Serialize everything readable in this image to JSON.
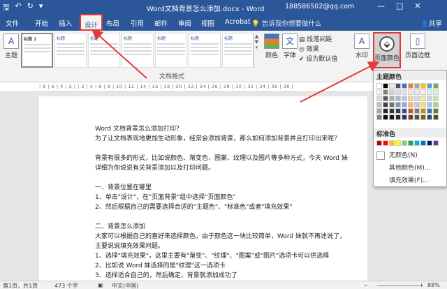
{
  "titlebar": {
    "title": "Word文档背景怎么添加.docx - Word",
    "user": "188586502@qq.com",
    "qat_save_icon": "save-icon",
    "undo": "↶",
    "redo": "↻",
    "save": "🖫",
    "quick": "▾",
    "restore_icon": "restore-icon",
    "minimize": "—",
    "maximize": "□",
    "close": "✕"
  },
  "tabs": {
    "file": "文件",
    "home": "开始",
    "insert": "插入",
    "design": "设计",
    "layout": "布局",
    "references": "引用",
    "mailings": "邮件",
    "review": "审阅",
    "view": "视图",
    "acrobat": "Acrobat",
    "tellme": "告诉我你想要做什么",
    "share": "共享"
  },
  "ribbon": {
    "theme": "主题",
    "style_first": "标题 1",
    "style_titles": [
      "标题",
      "标题",
      "标题",
      "标题",
      "标题",
      "标题"
    ],
    "colors": "颜色",
    "fonts": "字体",
    "fonts_glyph": "文",
    "paragraph_spacing": "段落间距",
    "effects": "效果",
    "set_default": "设为默认值",
    "watermark": "水印",
    "page_color": "页面颜色",
    "page_border": "页面边框",
    "group_label": "文档格式"
  },
  "ruler": "| 8 | 6 | 4 | 2 |   | 2 | 4 | 6 | 8 | 10 | 12 | 14 | 16 | 18 | 20 | 22 | 24 | 26 | 28 | 30 | 32 | 34 | 36 | 38 |",
  "document": {
    "lines": [
      "Word 文档背景怎么添加打印？",
      "为了让文档表现地更加生动形象，经常会添加背景，那么如何添加背景并且打印出来呢？",
      "",
      "背景有很多的形式，比如说颜色、渐变色、图案、纹理以及图片等多种方式，今天 Word 妹",
      "详细为你说说有关背景添加以及打印问题。",
      "",
      "一、背景位置在哪里",
      "1、单击\"设计\"，在\"页面背景\"组中选择\"页面颜色\"",
      "2、然后根据自己的需要选择合适的\"主题色\"、\"标准色\"或者\"填充效果\"",
      "",
      "二、背景怎么添加",
      "大家可以根据自己的喜好来选择颜色，由于颜色这一块比较简单，Word 妹就不再述说了，",
      "主要说说填充效果问题。",
      "1、选择\"填充效果\"，这里主要有\"渐变\"、\"纹理\"、\"图案\"或\"图片\"选项卡可以供选择",
      "2、比如说 Word 妹选择的是\"纹理\"这一选项卡",
      "3、选择适合自己的，然后确定，背景就添加成功了"
    ]
  },
  "dropdown": {
    "theme_colors": "主题颜色",
    "standard_colors": "标准色",
    "no_color": "无颜色(N)",
    "more_colors": "其他颜色(M)...",
    "fill_effects": "填充效果(F)...",
    "theme_grid": [
      [
        "#ffffff",
        "#000000",
        "#e7e6e6",
        "#44546a",
        "#4472c4",
        "#ed7d31",
        "#a5a5a5",
        "#ffc000",
        "#5b9bd5",
        "#70ad47"
      ],
      [
        "#f2f2f2",
        "#7f7f7f",
        "#d0cece",
        "#d6dce5",
        "#d9e2f3",
        "#fbe5d6",
        "#ededed",
        "#fff2cc",
        "#deebf7",
        "#e2f0d9"
      ],
      [
        "#d9d9d9",
        "#595959",
        "#aeabab",
        "#adb9ca",
        "#b4c7e7",
        "#f8cbad",
        "#dbdbdb",
        "#ffe699",
        "#bdd7ee",
        "#c5e0b4"
      ],
      [
        "#bfbfbf",
        "#404040",
        "#757171",
        "#8497b0",
        "#8faadc",
        "#f4b183",
        "#c9c9c9",
        "#ffd966",
        "#9dc3e6",
        "#a9d18e"
      ],
      [
        "#a6a6a6",
        "#262626",
        "#3a3838",
        "#333f50",
        "#2f5597",
        "#c55a11",
        "#7b7b7b",
        "#bf9000",
        "#2e75b6",
        "#548235"
      ],
      [
        "#808080",
        "#0d0d0d",
        "#171616",
        "#222a35",
        "#1f3864",
        "#833c0b",
        "#525252",
        "#7f6000",
        "#1f4e79",
        "#385723"
      ]
    ],
    "standard_row": [
      "#c00000",
      "#ff0000",
      "#ffc000",
      "#ffff00",
      "#92d050",
      "#00b050",
      "#00b0f0",
      "#0070c0",
      "#002060",
      "#7030a0"
    ]
  },
  "status": {
    "page": "第1页，共1页",
    "words": "473 个字",
    "lang": "中文(中国)",
    "zoom": "88%"
  },
  "colors": {
    "word_blue": "#2b579a",
    "annotation_red": "#e03b3b"
  }
}
